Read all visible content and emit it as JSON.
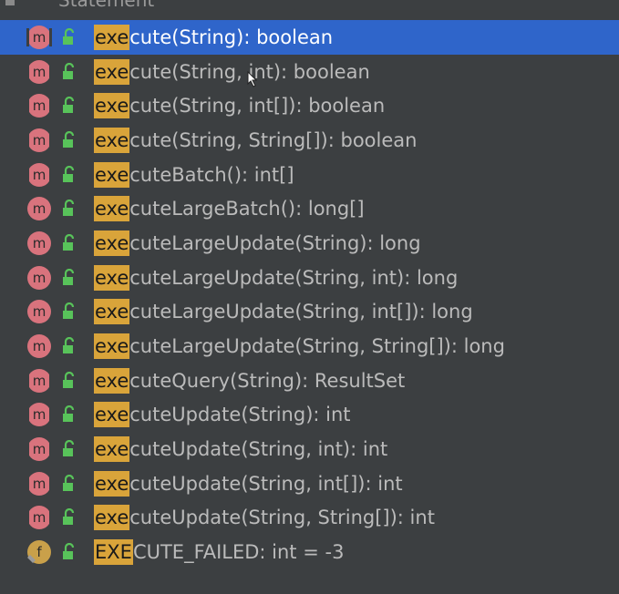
{
  "header": {
    "title": "Statement"
  },
  "colors": {
    "background": "#3c3f41",
    "selection": "#2f65ca",
    "match_highlight": "#d9a43a",
    "method_badge": "#d9737d",
    "field_badge": "#c9a04a",
    "public_lock": "#58c35a"
  },
  "items": [
    {
      "match": "exe",
      "rest": "cute(String): boolean",
      "kind": "method",
      "kind_letter": "m",
      "abstract": true,
      "selected": true
    },
    {
      "match": "exe",
      "rest": "cute(String, int): boolean",
      "kind": "method",
      "kind_letter": "m",
      "abstract": true
    },
    {
      "match": "exe",
      "rest": "cute(String, int[]): boolean",
      "kind": "method",
      "kind_letter": "m",
      "abstract": true
    },
    {
      "match": "exe",
      "rest": "cute(String, String[]): boolean",
      "kind": "method",
      "kind_letter": "m",
      "abstract": true
    },
    {
      "match": "exe",
      "rest": "cuteBatch(): int[]",
      "kind": "method",
      "kind_letter": "m",
      "abstract": true
    },
    {
      "match": "exe",
      "rest": "cuteLargeBatch(): long[]",
      "kind": "method",
      "kind_letter": "m",
      "abstract": false
    },
    {
      "match": "exe",
      "rest": "cuteLargeUpdate(String): long",
      "kind": "method",
      "kind_letter": "m",
      "abstract": false
    },
    {
      "match": "exe",
      "rest": "cuteLargeUpdate(String, int): long",
      "kind": "method",
      "kind_letter": "m",
      "abstract": false
    },
    {
      "match": "exe",
      "rest": "cuteLargeUpdate(String, int[]): long",
      "kind": "method",
      "kind_letter": "m",
      "abstract": false
    },
    {
      "match": "exe",
      "rest": "cuteLargeUpdate(String, String[]): long",
      "kind": "method",
      "kind_letter": "m",
      "abstract": false
    },
    {
      "match": "exe",
      "rest": "cuteQuery(String): ResultSet",
      "kind": "method",
      "kind_letter": "m",
      "abstract": true
    },
    {
      "match": "exe",
      "rest": "cuteUpdate(String): int",
      "kind": "method",
      "kind_letter": "m",
      "abstract": true
    },
    {
      "match": "exe",
      "rest": "cuteUpdate(String, int): int",
      "kind": "method",
      "kind_letter": "m",
      "abstract": true
    },
    {
      "match": "exe",
      "rest": "cuteUpdate(String, int[]): int",
      "kind": "method",
      "kind_letter": "m",
      "abstract": true
    },
    {
      "match": "exe",
      "rest": "cuteUpdate(String, String[]): int",
      "kind": "method",
      "kind_letter": "m",
      "abstract": true
    },
    {
      "match": "EXE",
      "rest": "CUTE_FAILED: int = -3",
      "kind": "field",
      "kind_letter": "f",
      "abstract": false
    }
  ]
}
